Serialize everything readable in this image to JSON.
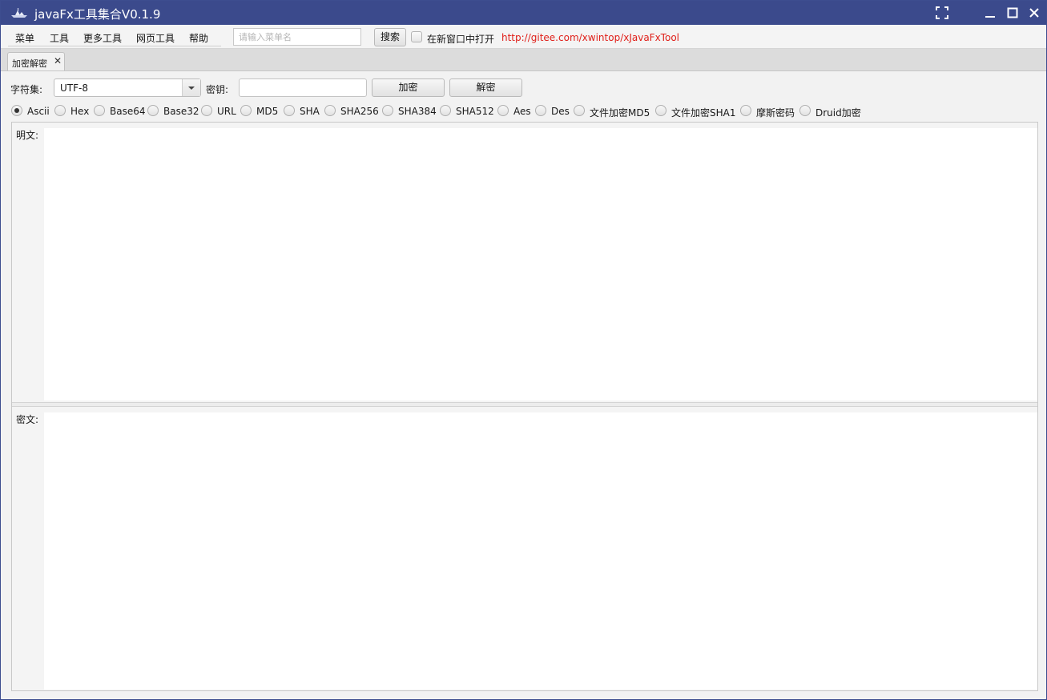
{
  "window": {
    "title": "javaFx工具集合V0.1.9",
    "icon": "ship-icon"
  },
  "menubar": {
    "items": [
      "菜单",
      "工具",
      "更多工具",
      "网页工具",
      "帮助"
    ],
    "search_placeholder": "请输入菜单名",
    "search_button": "搜索",
    "new_window_label": "在新窗口中打开",
    "link_text": "http://gitee.com/xwintop/xJavaFxTool"
  },
  "tabs": [
    {
      "label": "加密解密",
      "close": "✕"
    }
  ],
  "toolbar": {
    "charset_label": "字符集:",
    "charset_value": "UTF-8",
    "key_label": "密钥:",
    "key_value": "",
    "encrypt_button": "加密",
    "decrypt_button": "解密"
  },
  "algorithms": {
    "selected": "Ascii",
    "options": [
      "Ascii",
      "Hex",
      "Base64",
      "Base32",
      "URL",
      "MD5",
      "SHA",
      "SHA256",
      "SHA384",
      "SHA512",
      "Aes",
      "Des",
      "文件加密MD5",
      "文件加密SHA1",
      "摩斯密码",
      "Druid加密"
    ]
  },
  "panes": {
    "plain_label": "明文:",
    "plain_value": "",
    "cipher_label": "密文:",
    "cipher_value": ""
  },
  "colors": {
    "titlebar": "#3b4a8c",
    "link": "#e0201a"
  }
}
